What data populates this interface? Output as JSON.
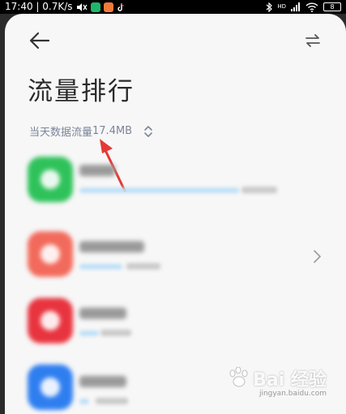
{
  "statusbar": {
    "time_speed": "17:40 | 0.7K/s",
    "battery": "8",
    "network_label": "HD"
  },
  "page": {
    "title": "流量排行",
    "today_label": "当天数据流量",
    "today_value": "17.4MB"
  },
  "icons": {
    "back": "arrow-left-icon",
    "swap": "swap-arrows-icon",
    "sort": "sort-updown-icon",
    "chevron": "chevron-right-icon"
  },
  "apps": [
    {
      "color": "#2fc25b",
      "usage_fraction": 0.82
    },
    {
      "color": "#f26a5b",
      "usage_fraction": 0.22
    },
    {
      "color": "#e8343f",
      "usage_fraction": 0.1
    },
    {
      "color": "#2f7ef0",
      "usage_fraction": 0.05
    }
  ],
  "colors": {
    "accent_text": "#7c8599",
    "annotation": "#e53935",
    "sheet_bg": "#f7f7f7"
  },
  "watermark": {
    "brand": "Bai 经验",
    "url": "jingyan.baidu.com"
  }
}
